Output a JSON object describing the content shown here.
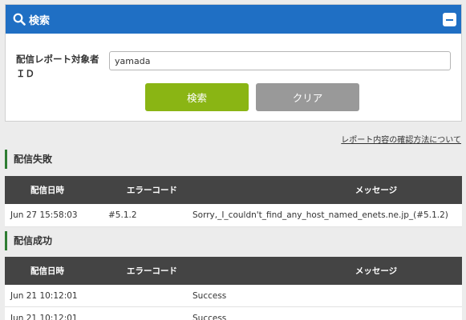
{
  "search_panel": {
    "title": "検索",
    "field_label_line1": "配信レポート対象者",
    "field_label_line2": "ＩＤ",
    "input_value": "yamada",
    "search_button": "検索",
    "clear_button": "クリア"
  },
  "help_link": "レポート内容の確認方法について",
  "failed": {
    "title": "配信失敗",
    "headers": [
      "配信日時",
      "エラーコード",
      "メッセージ"
    ],
    "rows": [
      {
        "date": "Jun 27 15:58:03",
        "code": "#5.1.2",
        "message": "Sorry,_I_couldn't_find_any_host_named_enets.ne.jp_(#5.1.2)"
      }
    ]
  },
  "success": {
    "title": "配信成功",
    "headers": [
      "配信日時",
      "エラーコード",
      "メッセージ"
    ],
    "rows": [
      {
        "date": "Jun 21 10:12:01",
        "code": "",
        "message": "Success"
      },
      {
        "date": "Jun 21 10:12:01",
        "code": "",
        "message": "Success"
      }
    ]
  },
  "colors": {
    "header_blue": "#1f6fc4",
    "search_green": "#8ab514",
    "clear_gray": "#999999",
    "table_header": "#444444",
    "section_accent": "#2e7d32"
  }
}
